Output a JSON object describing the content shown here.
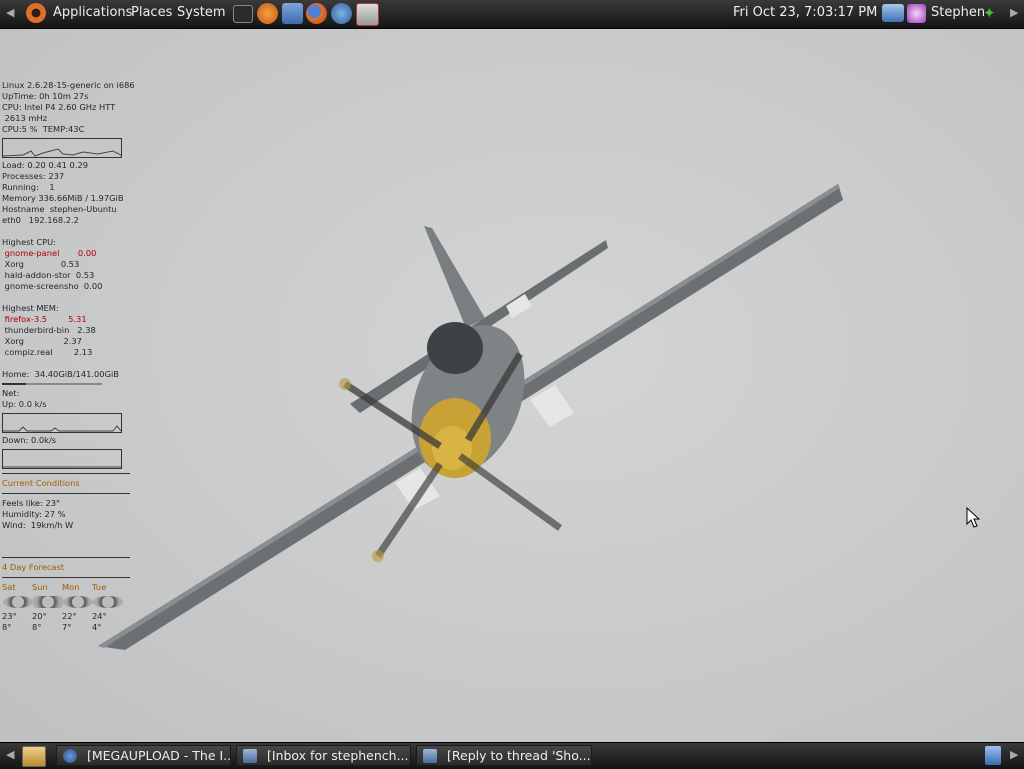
{
  "top_panel": {
    "menus": [
      "Applications",
      "Places",
      "System"
    ],
    "launchers": [
      "terminal-icon",
      "gimp-icon",
      "home-folder-icon",
      "firefox-icon",
      "thunderbird-icon",
      "package-manager-icon"
    ],
    "clock": "Fri Oct 23,  7:03:17 PM",
    "user_name": "Stephen",
    "tray_icons": [
      "network-icon",
      "session-icon",
      "user-status-icon"
    ]
  },
  "conky": {
    "system": [
      "Linux 2.6.28-15-generic on i686",
      "UpTime: 0h 10m 27s",
      "CPU: Intel P4 2.60 GHz HTT",
      " 2613 mHz",
      "CPU:5 %  TEMP:43C"
    ],
    "stats": [
      "Load: 0.20 0.41 0.29",
      "Processes: 237",
      "Running:    1",
      "Memory 336.66MiB / 1.97GiB",
      "Hostname  stephen-Ubuntu",
      "eth0   192.168.2.2"
    ],
    "highest_cpu_title": "Highest CPU:",
    "highest_cpu": [
      {
        "text": " gnome-panel       0.00",
        "hi": true
      },
      {
        "text": " Xorg              0.53",
        "hi": false
      },
      {
        "text": " hald-addon-stor  0.53",
        "hi": false
      },
      {
        "text": " gnome-screensho  0.00",
        "hi": false
      }
    ],
    "highest_mem_title": "Highest MEM:",
    "highest_mem": [
      {
        "text": " firefox-3.5        5.31",
        "hi": true
      },
      {
        "text": " thunderbird-bin   2.38",
        "hi": false
      },
      {
        "text": " Xorg               2.37",
        "hi": false
      },
      {
        "text": " compiz.real        2.13",
        "hi": false
      }
    ],
    "home": "Home:  34.40GiB/141.00GiB",
    "home_used_fraction": 0.244,
    "net_title": "Net:",
    "up": "Up: 0.0 k/s",
    "down": "Down: 0.0k/s",
    "current_conditions_title": "Current Conditions",
    "conditions": [
      "Feels like: 23°",
      "Humidity: 27 %",
      "Wind:  19km/h W"
    ],
    "forecast_title": "4 Day Forecast",
    "forecast": [
      {
        "day": "Sat",
        "high": "23°",
        "low": "8°",
        "icon": "sunny-icon"
      },
      {
        "day": "Sun",
        "high": "20°",
        "low": "8°",
        "icon": "cloudy-icon"
      },
      {
        "day": "Mon",
        "high": "22°",
        "low": "7°",
        "icon": "sunny-icon"
      },
      {
        "day": "Tue",
        "high": "24°",
        "low": "4°",
        "icon": "sunny-icon"
      }
    ]
  },
  "taskbar": {
    "tasks": [
      {
        "label": "[MEGAUPLOAD - The I...",
        "icon": "firefox-icon"
      },
      {
        "label": "[Inbox for stephench...",
        "icon": "thunderbird-icon"
      },
      {
        "label": "[Reply to thread 'Sho...",
        "icon": "thunderbird-icon"
      }
    ],
    "show_desktop_icon": "show-desktop-icon",
    "trash_icon": "trash-icon"
  },
  "colors": {
    "panel_bg": "#1f1f1f",
    "conky_highlight": "#b00000",
    "conky_section": "#a35a00"
  }
}
